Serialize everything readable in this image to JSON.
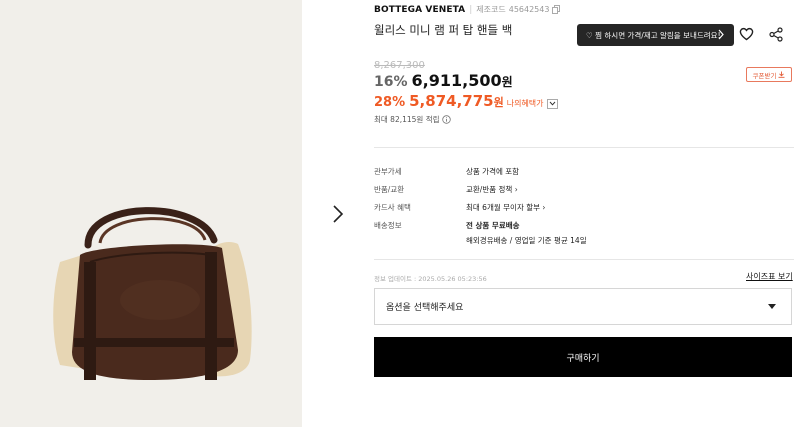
{
  "product": {
    "brand": "BOTTEGA VENETA",
    "code_label": "제조코드",
    "code_value": "45642543",
    "title": "윌리스 미니 램 퍼 탑 핸들 백"
  },
  "alert_button": {
    "label": "♡ 찜 하시면 가격/재고 알림을 보내드려요!"
  },
  "pricing": {
    "original": "8,267,300",
    "discount_percent": "16%",
    "price": "6,911,500",
    "won": "원",
    "benefit_percent": "28%",
    "benefit_price": "5,874,775",
    "benefit_won": "원",
    "benefit_label": "나의혜택가",
    "points_text": "최대 82,115원 적립"
  },
  "coupon": {
    "label": "쿠폰받기"
  },
  "info": [
    {
      "label": "관부가세",
      "value": "상품 가격에 포함",
      "arrow": ""
    },
    {
      "label": "반품/교환",
      "value": "교환/반품 정책",
      "arrow": "›"
    },
    {
      "label": "카드사 혜택",
      "value": "최대 6개월 무이자 할부",
      "arrow": "›"
    },
    {
      "label": "배송정보",
      "value": "전 상품 무료배송",
      "arrow": ""
    }
  ],
  "shipping_detail": "해외경유배송 / 영업일 기준 평균 14일",
  "update_info": "정보 업데이트 : 2025.05.26 05:23:56",
  "size_guide": "사이즈표 보기",
  "option_select": {
    "placeholder": "옵션을 선택해주세요"
  },
  "buy_button": {
    "label": "구매하기"
  },
  "colors": {
    "accent": "#ef5a24",
    "dark": "#262626",
    "gallery_bg": "#f1efea",
    "bag_brown": "#4a2a1d",
    "shearling": "#e7d6b4"
  },
  "icons": [
    "copy-icon",
    "chevron-right-icon",
    "heart-icon",
    "share-icon",
    "download-icon",
    "chevron-down-icon",
    "info-icon",
    "caret-down-icon"
  ]
}
